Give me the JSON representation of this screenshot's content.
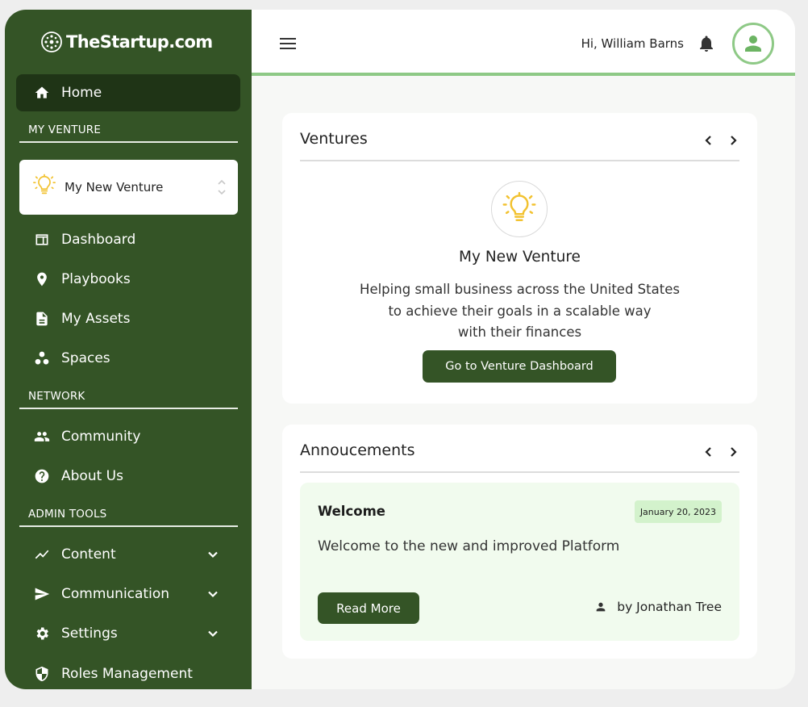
{
  "brand": {
    "name": "TheStartup.com"
  },
  "sidebar": {
    "home_label": "Home",
    "sections": {
      "my_venture": "MY VENTURE",
      "network": "NETWORK",
      "admin_tools": "ADMIN TOOLS"
    },
    "venture_selector": {
      "value": "My New Venture"
    },
    "venture_items": [
      {
        "label": "Dashboard",
        "icon": "dashboard-icon"
      },
      {
        "label": "Playbooks",
        "icon": "map-pin-icon"
      },
      {
        "label": "My Assets",
        "icon": "document-icon"
      },
      {
        "label": "Spaces",
        "icon": "spaces-icon"
      }
    ],
    "network_items": [
      {
        "label": "Community",
        "icon": "people-icon"
      },
      {
        "label": "About Us",
        "icon": "help-icon"
      }
    ],
    "admin_items": [
      {
        "label": "Content",
        "icon": "trend-icon",
        "expandable": true
      },
      {
        "label": "Communication",
        "icon": "send-icon",
        "expandable": true
      },
      {
        "label": "Settings",
        "icon": "gear-icon",
        "expandable": true
      },
      {
        "label": "Roles Management",
        "icon": "shield-icon",
        "expandable": false
      }
    ]
  },
  "topbar": {
    "greeting": "Hi, William Barns"
  },
  "ventures_card": {
    "title": "Ventures",
    "venture_name": "My New Venture",
    "description_lines": [
      "Helping small business across the United States",
      "to achieve their goals in a scalable way",
      "with their finances"
    ],
    "button_label": "Go to Venture Dashboard"
  },
  "announcements_card": {
    "title": "Annoucements",
    "item": {
      "title": "Welcome",
      "date": "January 20, 2023",
      "body": "Welcome to the new and improved Platform",
      "button_label": "Read More",
      "author": "by Jonathan Tree"
    }
  },
  "colors": {
    "sidebar_bg": "#345426",
    "sidebar_active": "#1f3416",
    "accent_green": "#8ec986",
    "bulb_yellow": "#f2c230",
    "announcement_bg": "#f1fbee",
    "date_badge": "#d3f2cc"
  }
}
